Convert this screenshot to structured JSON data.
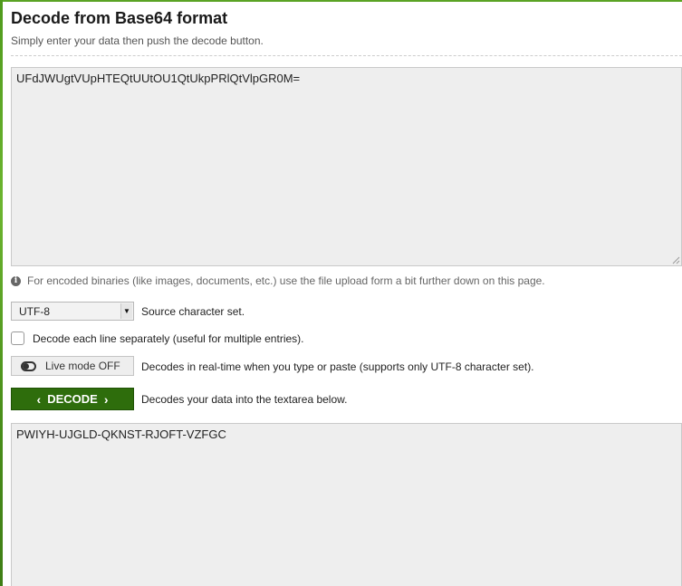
{
  "header": {
    "title": "Decode from Base64 format",
    "subtitle": "Simply enter your data then push the decode button."
  },
  "input": {
    "value": "UFdJWUgtVUpHTEQtUUtOU1QtUkpPRlQtVlpGR0M="
  },
  "hint": {
    "icon": "info-icon",
    "text": "For encoded binaries (like images, documents, etc.) use the file upload form a bit further down on this page."
  },
  "charset": {
    "selected": "UTF-8",
    "label": "Source character set."
  },
  "each_line": {
    "checked": false,
    "label": "Decode each line separately (useful for multiple entries)."
  },
  "live_mode": {
    "icon": "toggle-off-icon",
    "button_label": "Live mode OFF",
    "description": "Decodes in real-time when you type or paste (supports only UTF-8 character set)."
  },
  "decode": {
    "button_label": "DECODE",
    "description": "Decodes your data into the textarea below."
  },
  "output": {
    "value": "PWIYH-UJGLD-QKNST-RJOFT-VZFGC"
  },
  "colors": {
    "accent_green": "#2e6d0c",
    "field_background": "#eeeeee"
  }
}
